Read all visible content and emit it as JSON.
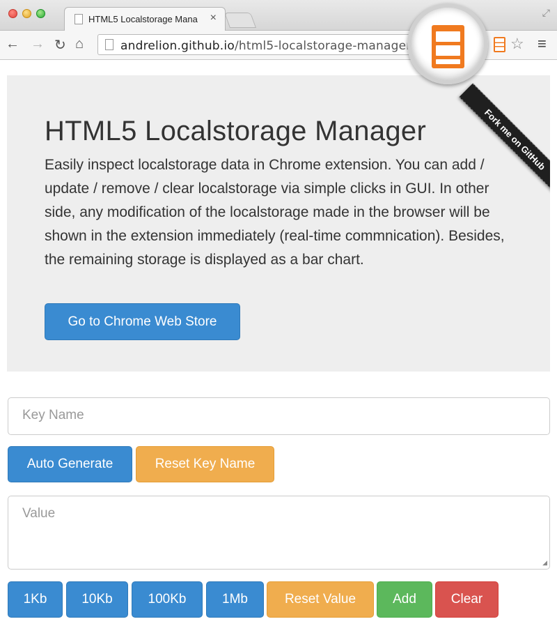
{
  "browser": {
    "tab_title": "HTML5 Localstorage Mana",
    "tab_close": "×",
    "url_host": "andrelion.github.io",
    "url_path": "/html5-localstorage-manager/",
    "back_icon": "←",
    "forward_icon": "→",
    "reload_icon": "↻",
    "home_icon": "⌂",
    "star_icon": "☆",
    "menu_icon": "≡",
    "resize_icon": "⤢"
  },
  "ribbon": {
    "label": "Fork me on GitHub"
  },
  "jumbotron": {
    "title": "HTML5 Localstorage Manager",
    "lead": "Easily inspect localstorage data in Chrome extension. You can add / update / remove / clear localstorage via simple clicks in GUI. In other side, any modification of the localstorage made in the browser will be shown in the extension immediately (real-time commnication). Besides, the remaining storage is displayed as a bar chart.",
    "store_button": "Go to Chrome Web Store"
  },
  "form": {
    "key_placeholder": "Key Name",
    "auto_generate": "Auto Generate",
    "reset_key": "Reset Key Name",
    "value_placeholder": "Value",
    "size_buttons": [
      "1Kb",
      "10Kb",
      "100Kb",
      "1Mb"
    ],
    "reset_value": "Reset Value",
    "add": "Add",
    "clear": "Clear"
  },
  "colors": {
    "primary": "#3a8bd1",
    "warning": "#f0ad4e",
    "success": "#5cb85c",
    "danger": "#d9534f",
    "extension_accent": "#f07a1f"
  }
}
